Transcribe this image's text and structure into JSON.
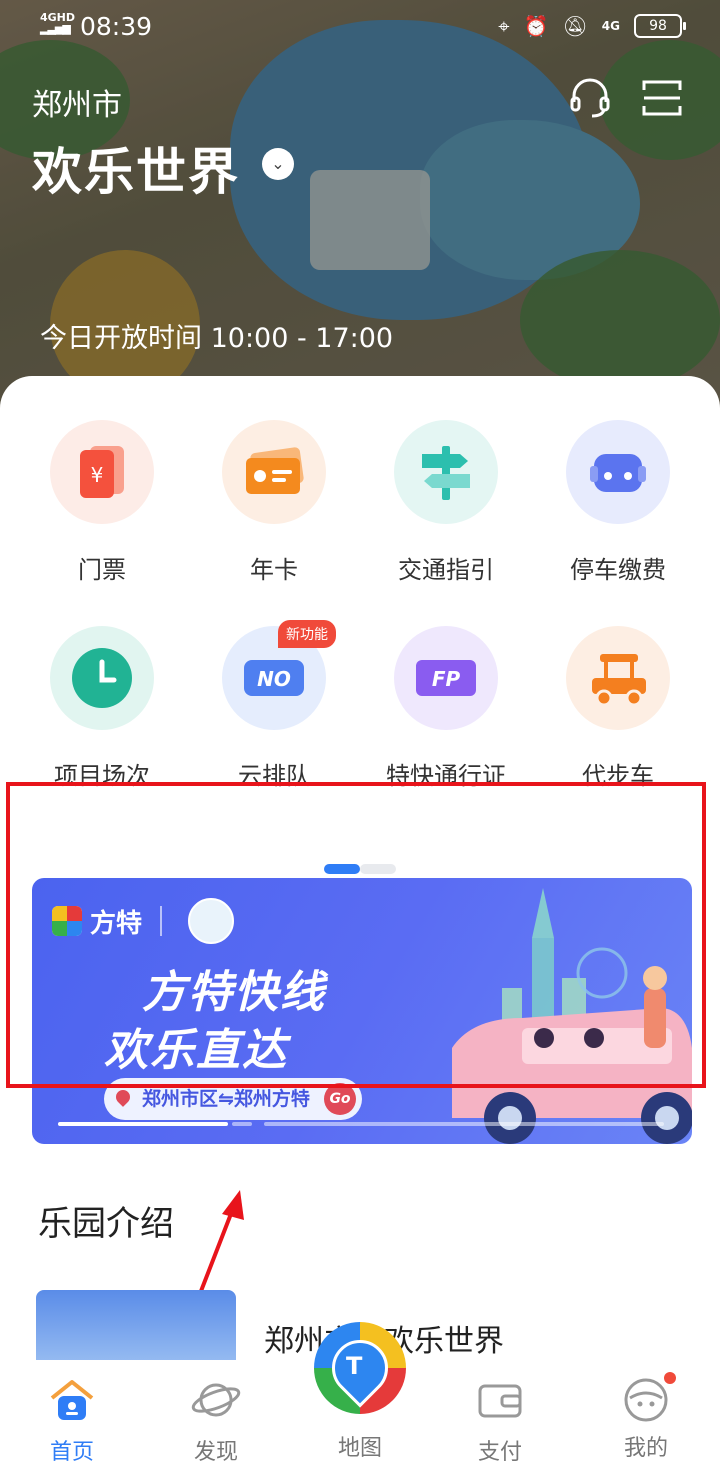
{
  "status_bar": {
    "network": "4GHD",
    "time": "08:39",
    "mobile": "4G",
    "battery": "98"
  },
  "header": {
    "city": "郑州市",
    "park_name": "欢乐世界",
    "hours": "今日开放时间 10:00 - 17:00"
  },
  "grid_items": [
    {
      "label": "门票",
      "icon": "ticket-icon",
      "color": "#f4513d",
      "bg": "#fdece7"
    },
    {
      "label": "年卡",
      "icon": "card-icon",
      "color": "#f48a1e",
      "bg": "#fdeee3"
    },
    {
      "label": "交通指引",
      "icon": "signpost-icon",
      "color": "#2cbfae",
      "bg": "#e4f6f3"
    },
    {
      "label": "停车缴费",
      "icon": "car-icon",
      "color": "#5b74ef",
      "bg": "#e7ebfd"
    },
    {
      "label": "项目场次",
      "icon": "clock-icon",
      "color": "#21b394",
      "bg": "#e1f5f0"
    },
    {
      "label": "云排队",
      "icon": "queue-icon",
      "color": "#4f7ff0",
      "bg": "#e5edfd",
      "badge": "新功能"
    },
    {
      "label": "特快通行证",
      "icon": "fastpass-icon",
      "color": "#8a5cf0",
      "bg": "#efe8fd"
    },
    {
      "label": "代步车",
      "icon": "cart-icon",
      "color": "#f47f1f",
      "bg": "#fdeee3"
    }
  ],
  "banner": {
    "brand": "方特",
    "headline_1": "方特快线",
    "headline_2": "欢乐直达",
    "route": "郑州市区⇋郑州方特",
    "go": "Go"
  },
  "section": {
    "title": "乐园介绍",
    "item_name": "郑州方特欢乐世界"
  },
  "tabs": [
    {
      "label": "首页",
      "icon": "home-icon",
      "active": true
    },
    {
      "label": "发现",
      "icon": "planet-icon",
      "active": false
    },
    {
      "label": "地图",
      "icon": "map-pin-icon",
      "active": false
    },
    {
      "label": "支付",
      "icon": "wallet-icon",
      "active": false
    },
    {
      "label": "我的",
      "icon": "profile-icon",
      "active": false
    }
  ],
  "colors": {
    "accent": "#2f7df6",
    "highlight": "#e8141b",
    "banner": "#5a6cf3"
  }
}
